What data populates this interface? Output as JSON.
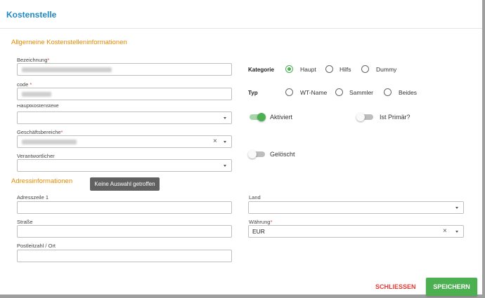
{
  "dialog": {
    "title": "Kostenstelle"
  },
  "general": {
    "section_title": "Allgerneine Kostenstelleninformationen",
    "bezeichnung_label": "Bezeichnung",
    "code_label": "code ",
    "hauptkostenstelle_label": "Hauptkostenstelle",
    "geschaeftsbereiche_label": "Geschäftsbereiche",
    "verantwortlicher_label": "Verantwortlicher",
    "required_mark": "*",
    "clear_icon": "×"
  },
  "kategorie": {
    "label": "Kategorie",
    "options": [
      "Haupt",
      "Hilfs",
      "Dummy"
    ],
    "selected": "Haupt"
  },
  "typ": {
    "label": "Typ",
    "options": [
      "WT-Name",
      "Sammler",
      "Beides"
    ],
    "selected": ""
  },
  "toggles": {
    "aktiviert_label": "Aktiviert",
    "aktiviert_on": true,
    "ist_primaer_label": "Ist Primär?",
    "ist_primaer_on": false,
    "geloescht_label": "Gelöscht",
    "geloescht_on": false
  },
  "address": {
    "section_title": "Adressinformationen",
    "adresszeile_label": "Adresszeile 1",
    "strasse_label": "Straße",
    "postleitzahl_label": "Postleitzahl / Ort",
    "land_label": "Land",
    "waehrung_label": "Währung",
    "waehrung_value": "EUR"
  },
  "tooltip": {
    "text": "Keine Auswahl getroffen"
  },
  "buttons": {
    "close_label": "SCHLIESSEN",
    "save_label": "SPEICHERN"
  },
  "colors": {
    "accent_title": "#1e88c8",
    "section": "#e68a00",
    "success": "#4caf50",
    "danger": "#e53935"
  }
}
